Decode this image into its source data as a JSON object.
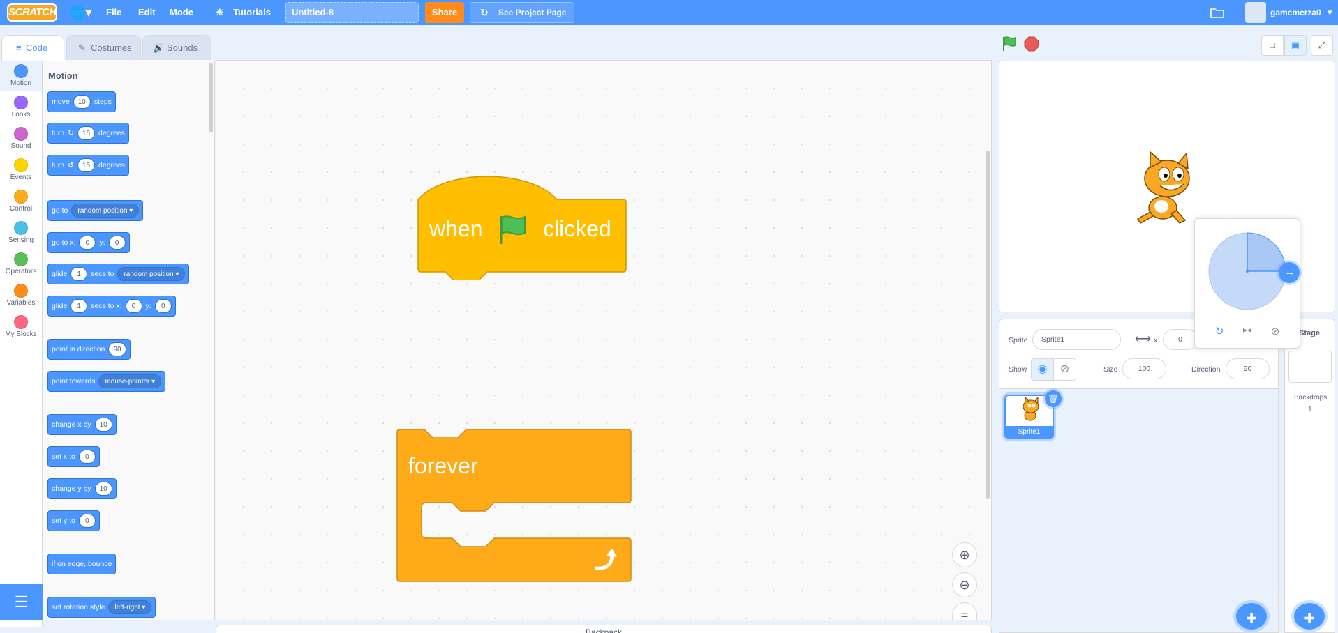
{
  "menu": {
    "logo": "SCRATCH",
    "file": "File",
    "edit": "Edit",
    "mode": "Mode",
    "tutorials": "Tutorials",
    "project_title": "Untitled-8",
    "share": "Share",
    "see_project_page": "See Project Page",
    "username": "gamemerza0"
  },
  "tabs": {
    "code": "Code",
    "costumes": "Costumes",
    "sounds": "Sounds"
  },
  "categories": [
    {
      "label": "Motion",
      "color": "#4c97ff"
    },
    {
      "label": "Looks",
      "color": "#9966ff"
    },
    {
      "label": "Sound",
      "color": "#cf63cf"
    },
    {
      "label": "Events",
      "color": "#ffd500"
    },
    {
      "label": "Control",
      "color": "#ffab19"
    },
    {
      "label": "Sensing",
      "color": "#4cbfe6"
    },
    {
      "label": "Operators",
      "color": "#59c059"
    },
    {
      "label": "Variables",
      "color": "#ff8c1a"
    },
    {
      "label": "My Blocks",
      "color": "#ff6680"
    }
  ],
  "palette": {
    "heading": "Motion",
    "move": {
      "a": "move",
      "v": "10",
      "b": "steps"
    },
    "turn_right": {
      "a": "turn",
      "v": "15",
      "b": "degrees"
    },
    "turn_left": {
      "a": "turn",
      "v": "15",
      "b": "degrees"
    },
    "goto": {
      "a": "go to",
      "dd": "random position"
    },
    "gotoxy": {
      "a": "go to x:",
      "x": "0",
      "b": "y:",
      "y": "0"
    },
    "glide_to": {
      "a": "glide",
      "v": "1",
      "b": "secs to",
      "dd": "random position"
    },
    "glide_xy": {
      "a": "glide",
      "v": "1",
      "b": "secs to x:",
      "x": "0",
      "c": "y:",
      "y": "0"
    },
    "point_dir": {
      "a": "point in direction",
      "v": "90"
    },
    "point_towards": {
      "a": "point towards",
      "dd": "mouse-pointer"
    },
    "change_x": {
      "a": "change x by",
      "v": "10"
    },
    "set_x": {
      "a": "set x to",
      "v": "0"
    },
    "change_y": {
      "a": "change y by",
      "v": "10"
    },
    "set_y": {
      "a": "set y to",
      "v": "0"
    },
    "bounce": {
      "a": "if on edge, bounce"
    },
    "rotation_style": {
      "a": "set rotation style",
      "dd": "left-right"
    }
  },
  "workspace": {
    "hat_when": "when",
    "hat_clicked": "clicked",
    "forever": "forever",
    "backpack": "Backpack",
    "colors": {
      "events": "#ffbf00",
      "control": "#ffab19"
    }
  },
  "sprite_info": {
    "sprite_label": "Sprite",
    "sprite_name": "Sprite1",
    "x_label": "x",
    "x_value": "0",
    "show_label": "Show",
    "size_label": "Size",
    "size_value": "100",
    "direction_label": "Direction",
    "direction_value": "90"
  },
  "sprite_list": [
    {
      "name": "Sprite1"
    }
  ],
  "stage_pane": {
    "title": "Stage",
    "backdrops_label": "Backdrops",
    "backdrops_count": "1"
  }
}
